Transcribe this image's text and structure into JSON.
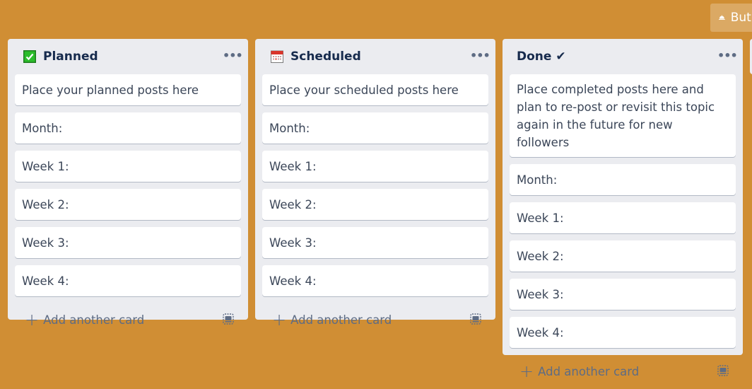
{
  "header": {
    "butler_button_label": "Butler",
    "butler_icon": "bell-icon"
  },
  "lists": [
    {
      "title": "Planned",
      "title_icon": "green-checkbox-icon",
      "menu_icon": "more-horizontal-icon",
      "cards": [
        "Place your planned posts here",
        "Month:",
        "Week 1:",
        "Week 2:",
        "Week 3:",
        "Week 4:"
      ],
      "add_card_label": "Add another card",
      "template_icon": "card-template-icon"
    },
    {
      "title": "Scheduled",
      "title_icon": "calendar-icon",
      "menu_icon": "more-horizontal-icon",
      "cards": [
        "Place your scheduled posts here",
        "Month:",
        "Week 1:",
        "Week 2:",
        "Week 3:",
        "Week 4:"
      ],
      "add_card_label": "Add another card",
      "template_icon": "card-template-icon"
    },
    {
      "title": "Done ✔",
      "title_icon": "",
      "menu_icon": "more-horizontal-icon",
      "cards": [
        "Place completed posts here and plan to re-post or revisit this topic again in the future for new followers",
        "Month:",
        "Week 1:",
        "Week 2:",
        "Week 3:",
        "Week 4:"
      ],
      "add_card_label": "Add another card",
      "template_icon": "card-template-icon"
    }
  ],
  "colors": {
    "board_background": "#d08e34",
    "list_background": "#ebecf0",
    "card_background": "#ffffff",
    "title_text": "#172b4d",
    "card_text": "#3b4658",
    "muted_text": "#5e6c84"
  }
}
